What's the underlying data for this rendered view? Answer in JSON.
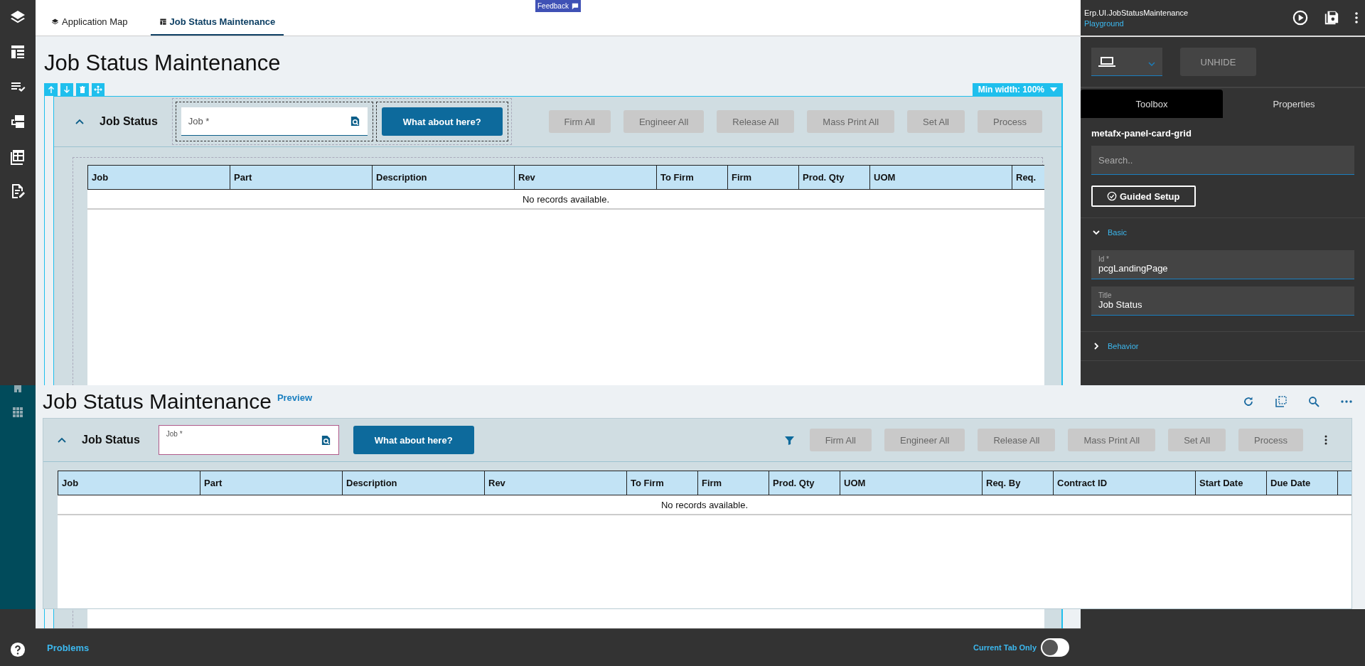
{
  "feedback": "Feedback",
  "tabs": [
    {
      "label": "Application Map",
      "selected": false
    },
    {
      "label": "Job Status Maintenance",
      "selected": true
    }
  ],
  "designer": {
    "title": "Job Status Maintenance",
    "min_width": "Min width: 100%",
    "card": {
      "title": "Job Status",
      "expanded": true,
      "job_field": {
        "placeholder": "Job *"
      },
      "action_button": "What about here?",
      "buttons": [
        {
          "label": "Firm All",
          "disabled": true
        },
        {
          "label": "Engineer All",
          "disabled": true
        },
        {
          "label": "Release All",
          "disabled": true
        },
        {
          "label": "Mass Print All",
          "disabled": true
        },
        {
          "label": "Set All",
          "disabled": true
        },
        {
          "label": "Process",
          "disabled": true
        }
      ],
      "columns": [
        "Job",
        "Part",
        "Description",
        "Rev",
        "To Firm",
        "Firm",
        "Prod. Qty",
        "UOM",
        "Req."
      ],
      "empty": "No records available."
    }
  },
  "preview": {
    "title": "Job Status Maintenance",
    "badge": "Preview",
    "card": {
      "title": "Job Status",
      "expanded": true,
      "job_field": {
        "label": "Job *"
      },
      "action_button": "What about here?",
      "buttons": [
        {
          "label": "Firm All",
          "disabled": true
        },
        {
          "label": "Engineer All",
          "disabled": true
        },
        {
          "label": "Release All",
          "disabled": true
        },
        {
          "label": "Mass Print All",
          "disabled": true
        },
        {
          "label": "Set All",
          "disabled": true
        },
        {
          "label": "Process",
          "disabled": true
        }
      ],
      "columns": [
        "Job",
        "Part",
        "Description",
        "Rev",
        "To Firm",
        "Firm",
        "Prod. Qty",
        "UOM",
        "Req. By",
        "Contract ID",
        "Start Date",
        "Due Date"
      ],
      "empty": "No records available."
    }
  },
  "inspector": {
    "name": "Erp.UI.JobStatusMaintenance",
    "subtitle": "Playground",
    "unhide": "UNHIDE",
    "tabs": [
      {
        "label": "Toolbox",
        "selected": true
      },
      {
        "label": "Properties",
        "selected": false
      }
    ],
    "component": "metafx-panel-card-grid",
    "search": {
      "placeholder": "Search.."
    },
    "guided_setup": "Guided Setup",
    "sections": [
      {
        "label": "Basic",
        "expanded": true,
        "fields": [
          {
            "label": "Id *",
            "value": "pcgLandingPage"
          },
          {
            "label": "Title",
            "value": "Job Status"
          }
        ]
      },
      {
        "label": "Behavior",
        "expanded": false
      }
    ]
  },
  "bottom_bar": {
    "problems": "Problems",
    "toggle": {
      "label": "Current Tab Only",
      "on": false
    }
  }
}
